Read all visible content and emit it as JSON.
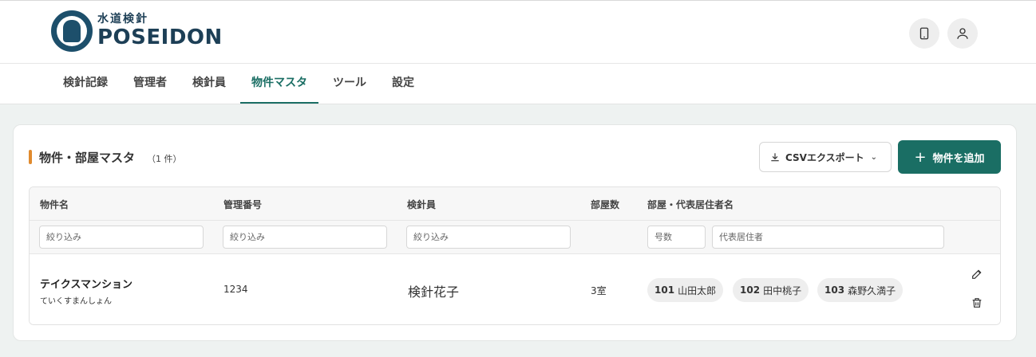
{
  "header": {
    "logo_sub": "水道検針",
    "logo_main": "POSEIDON",
    "device_icon": "smartphone-icon",
    "account_icon": "user-icon"
  },
  "tabs": [
    {
      "label": "検針記録",
      "active": false
    },
    {
      "label": "管理者",
      "active": false
    },
    {
      "label": "検針員",
      "active": false
    },
    {
      "label": "物件マスタ",
      "active": true
    },
    {
      "label": "ツール",
      "active": false
    },
    {
      "label": "設定",
      "active": false
    }
  ],
  "card": {
    "title": "物件・部屋マスタ",
    "count": "（1 件）",
    "csv_button": "CSVエクスポート",
    "add_button": "物件を追加"
  },
  "table": {
    "columns": [
      "物件名",
      "管理番号",
      "検針員",
      "部屋数",
      "部屋・代表居住者名"
    ],
    "filters": {
      "name": "絞り込み",
      "code": "絞り込み",
      "reader": "絞り込み",
      "room_no": "号数",
      "resident": "代表居住者"
    },
    "rows": [
      {
        "name": "テイクスマンション",
        "kana": "ていくすまんしょん",
        "code": "1234",
        "reader": "検針花子",
        "rooms": "3室",
        "residents": [
          {
            "room": "101",
            "name": "山田太郎"
          },
          {
            "room": "102",
            "name": "田中桃子"
          },
          {
            "room": "103",
            "name": "森野久満子"
          }
        ]
      }
    ]
  },
  "colors": {
    "primary": "#1a6e64",
    "accent": "#e08a2e",
    "brand": "#1d3f56"
  }
}
